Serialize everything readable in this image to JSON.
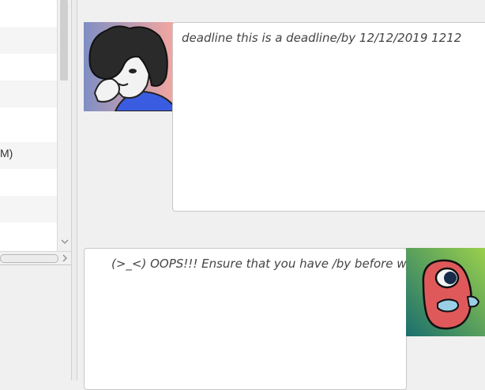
{
  "task_list": {
    "rows": [
      {
        "text": ""
      },
      {
        "text": ""
      },
      {
        "text": ""
      },
      {
        "text": ""
      },
      {
        "text": ""
      },
      {
        "text": "M)"
      },
      {
        "text": ""
      },
      {
        "text": ""
      },
      {
        "text": ""
      }
    ]
  },
  "chat": {
    "user_message": "deadline this is a deadline/by 12/12/2019 1212",
    "bot_message": "(>_<) OOPS!!! Ensure that you have /by before writing"
  },
  "colors": {
    "user_avatar_bg_start": "#7f8fc4",
    "user_avatar_bg_end": "#f3a6a0",
    "user_shirt": "#3a5ce0",
    "bot_avatar_bg_start": "#1a6f6e",
    "bot_avatar_bg_end": "#9ad04c",
    "bot_body": "#e0595a"
  },
  "icons": {
    "vscroll_down": "chevron-down-icon",
    "hscroll_right": "chevron-right-icon"
  }
}
